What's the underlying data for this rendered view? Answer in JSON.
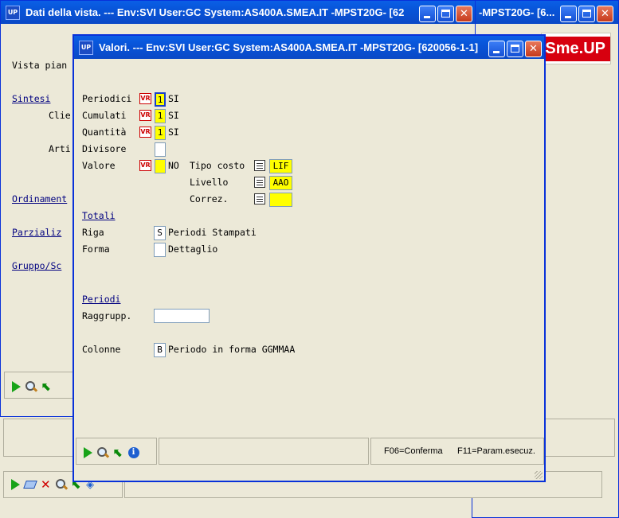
{
  "back_window": {
    "title": "Dati della vista. --- Env:SVI User:GC System:AS400A.SMEA.IT -MPST20G- [62",
    "title_tail": "-MPST20G- [6...",
    "logo": "Sme.UP",
    "labels": [
      "Vista pian",
      "Clie",
      "Arti"
    ],
    "sections": [
      "Sintesi",
      "Ordinament",
      "Parzializ",
      "Gruppo/Sc"
    ]
  },
  "front_window": {
    "title": "Valori. --- Env:SVI User:GC System:AS400A.SMEA.IT -MPST20G- [620056-1-1]",
    "rows": {
      "periodici": {
        "label": "Periodici",
        "value": "1",
        "desc": "SI"
      },
      "cumulati": {
        "label": "Cumulati",
        "value": "1",
        "desc": "SI"
      },
      "quantita": {
        "label": "Quantità",
        "value": "1",
        "desc": "SI"
      },
      "divisore": {
        "label": "Divisore",
        "value": ""
      },
      "valore": {
        "label": "Valore",
        "value": "",
        "desc": "NO"
      }
    },
    "right": {
      "tipo_costo": {
        "label": "Tipo costo",
        "value": "LIF"
      },
      "livello": {
        "label": "Livello",
        "value": "AAO"
      },
      "correz": {
        "label": "Correz.",
        "value": ""
      }
    },
    "totali": {
      "title": "Totali",
      "riga": {
        "label": "Riga",
        "value": "S",
        "desc": "Periodi Stampati"
      },
      "forma": {
        "label": "Forma",
        "value": "",
        "desc": "Dettaglio"
      }
    },
    "periodi": {
      "title": "Periodi",
      "raggrupp": {
        "label": "Raggrupp.",
        "value": ""
      },
      "colonne": {
        "label": "Colonne",
        "value": "B",
        "desc": "Periodo in forma GGMMAA"
      }
    },
    "status": {
      "f06": "F06=Conferma",
      "f11": "F11=Param.esecuz."
    },
    "vr_badge": "VR"
  },
  "colors": {
    "accent_yellow": "#ffff00",
    "title_blue": "#0a5fe6",
    "section_blue": "#000080"
  }
}
